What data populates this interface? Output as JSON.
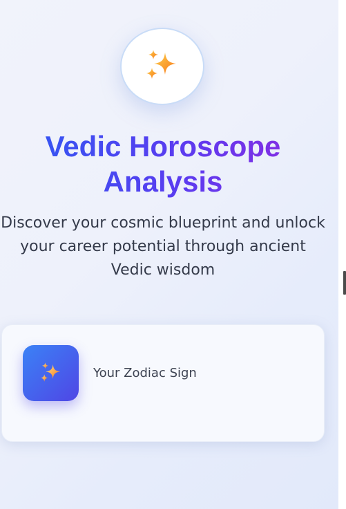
{
  "hero": {
    "icon": "sparkles-icon",
    "title": "Vedic Horoscope Analysis",
    "subtitle": "Discover your cosmic blueprint and unlock your career potential through ancient Vedic wisdom"
  },
  "card": {
    "icon": "sparkles-icon",
    "label": "Your Zodiac Sign"
  },
  "colors": {
    "title_gradient_start": "#2f59f2",
    "title_gradient_end": "#8a2be2",
    "card_icon_gradient_start": "#3b82f6",
    "card_icon_gradient_end": "#4f46e5",
    "sparkle": "#f59e0b"
  }
}
